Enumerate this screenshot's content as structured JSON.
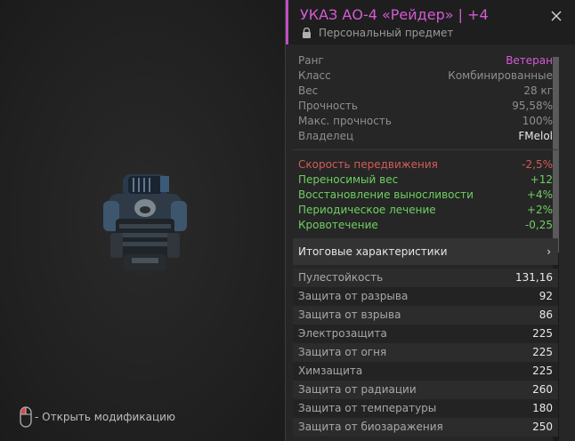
{
  "item": {
    "title": "УКАЗ АО-4 «Рейдер»",
    "upgrade": "| +4",
    "subtitle": "Персональный предмет"
  },
  "info": [
    {
      "label": "Ранг",
      "value": "Ветеран"
    },
    {
      "label": "Класс",
      "value": "Комбинированные"
    },
    {
      "label": "Вес",
      "value": "28 кг"
    },
    {
      "label": "Прочность",
      "value": "95,58%"
    },
    {
      "label": "Макс. прочность",
      "value": "100%"
    },
    {
      "label": "Владелец",
      "value": "FMelol"
    }
  ],
  "effects": [
    {
      "label": "Скорость передвижения",
      "value": "-2,5%",
      "kind": "negative"
    },
    {
      "label": "Переносимый вес",
      "value": "+12",
      "kind": "positive"
    },
    {
      "label": "Восстановление выносливости",
      "value": "+4%",
      "kind": "positive"
    },
    {
      "label": "Периодическое лечение",
      "value": "+2%",
      "kind": "positive"
    },
    {
      "label": "Кровотечение",
      "value": "-0,25",
      "kind": "positive"
    }
  ],
  "summary": {
    "label": "Итоговые характеристики",
    "chevron": "›"
  },
  "stats": [
    {
      "label": "Пулестойкость",
      "value": "131,16"
    },
    {
      "label": "Защита от разрыва",
      "value": "92"
    },
    {
      "label": "Защита от взрыва",
      "value": "86"
    },
    {
      "label": "Электрозащита",
      "value": "225"
    },
    {
      "label": "Защита от огня",
      "value": "225"
    },
    {
      "label": "Химзащита",
      "value": "225"
    },
    {
      "label": "Защита от радиации",
      "value": "260"
    },
    {
      "label": "Защита от температуры",
      "value": "180"
    },
    {
      "label": "Защита от биозаражения",
      "value": "250"
    }
  ],
  "hint": {
    "text": "- Открыть модификацию",
    "icon": "mouse-icon"
  },
  "colors": {
    "accent": "#c04fc4",
    "rank": "#d45bd3",
    "negative": "#d45a5a",
    "positive": "#6fcf62"
  }
}
